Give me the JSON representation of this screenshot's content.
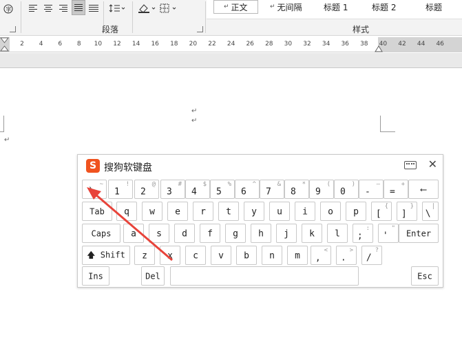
{
  "ribbon": {
    "paragraph_group_label": "段落",
    "styles_group_label": "样式",
    "styles": [
      {
        "label": "正文",
        "selected": true
      },
      {
        "label": "无间隔",
        "selected": false
      },
      {
        "label": "标题 1",
        "selected": false
      },
      {
        "label": "标题 2",
        "selected": false
      },
      {
        "label": "标题",
        "selected": false
      }
    ],
    "icons": [
      "font-circle-icon",
      "align-left-icon",
      "align-center-icon",
      "align-right-icon",
      "justify-icon",
      "distributed-icon",
      "line-spacing-icon",
      "shading-icon",
      "borders-icon"
    ]
  },
  "ruler": {
    "numbers": [
      "2",
      "4",
      "6",
      "8",
      "10",
      "12",
      "14",
      "16",
      "18",
      "20",
      "22",
      "24",
      "26",
      "28",
      "30",
      "32",
      "34",
      "36",
      "38",
      "40",
      "42",
      "44",
      "46"
    ]
  },
  "keyboard": {
    "title": "搜狗软键盘",
    "logo_letter": "S",
    "close_symbol": "✕",
    "rows": [
      [
        {
          "main": "`",
          "sec": "~"
        },
        {
          "main": "1",
          "sec": "!"
        },
        {
          "main": "2",
          "sec": "@"
        },
        {
          "main": "3",
          "sec": "#"
        },
        {
          "main": "4",
          "sec": "$"
        },
        {
          "main": "5",
          "sec": "%"
        },
        {
          "main": "6",
          "sec": "^"
        },
        {
          "main": "7",
          "sec": "&"
        },
        {
          "main": "8",
          "sec": "*"
        },
        {
          "main": "9",
          "sec": "("
        },
        {
          "main": "0",
          "sec": ")"
        },
        {
          "main": "-",
          "sec": "—"
        },
        {
          "main": "=",
          "sec": "+"
        },
        {
          "main": "⟵",
          "sec": ""
        }
      ],
      [
        {
          "main": "Tab",
          "sec": ""
        },
        {
          "main": "q",
          "sec": ""
        },
        {
          "main": "w",
          "sec": ""
        },
        {
          "main": "e",
          "sec": ""
        },
        {
          "main": "r",
          "sec": ""
        },
        {
          "main": "t",
          "sec": ""
        },
        {
          "main": "y",
          "sec": ""
        },
        {
          "main": "u",
          "sec": ""
        },
        {
          "main": "i",
          "sec": ""
        },
        {
          "main": "o",
          "sec": ""
        },
        {
          "main": "p",
          "sec": ""
        },
        {
          "main": "[",
          "sec": "{"
        },
        {
          "main": "]",
          "sec": "}"
        },
        {
          "main": "\\",
          "sec": "|"
        }
      ],
      [
        {
          "main": "Caps",
          "sec": ""
        },
        {
          "main": "a",
          "sec": ""
        },
        {
          "main": "s",
          "sec": ""
        },
        {
          "main": "d",
          "sec": ""
        },
        {
          "main": "f",
          "sec": ""
        },
        {
          "main": "g",
          "sec": ""
        },
        {
          "main": "h",
          "sec": ""
        },
        {
          "main": "j",
          "sec": ""
        },
        {
          "main": "k",
          "sec": ""
        },
        {
          "main": "l",
          "sec": ""
        },
        {
          "main": ";",
          "sec": ":"
        },
        {
          "main": "'",
          "sec": "\""
        },
        {
          "main": "Enter",
          "sec": ""
        }
      ],
      [
        {
          "main": "🡅 Shift",
          "sec": ""
        },
        {
          "main": "z",
          "sec": ""
        },
        {
          "main": "x",
          "sec": ""
        },
        {
          "main": "c",
          "sec": ""
        },
        {
          "main": "v",
          "sec": ""
        },
        {
          "main": "b",
          "sec": ""
        },
        {
          "main": "n",
          "sec": ""
        },
        {
          "main": "m",
          "sec": ""
        },
        {
          "main": ",",
          "sec": "<"
        },
        {
          "main": ".",
          "sec": ">"
        },
        {
          "main": "/",
          "sec": "?"
        }
      ],
      [
        {
          "main": "Ins",
          "sec": ""
        },
        {
          "main": "Del",
          "sec": ""
        },
        {
          "main": "",
          "sec": ""
        },
        {
          "main": "Esc",
          "sec": ""
        }
      ]
    ]
  },
  "annotation_arrow_color": "#e8433a"
}
